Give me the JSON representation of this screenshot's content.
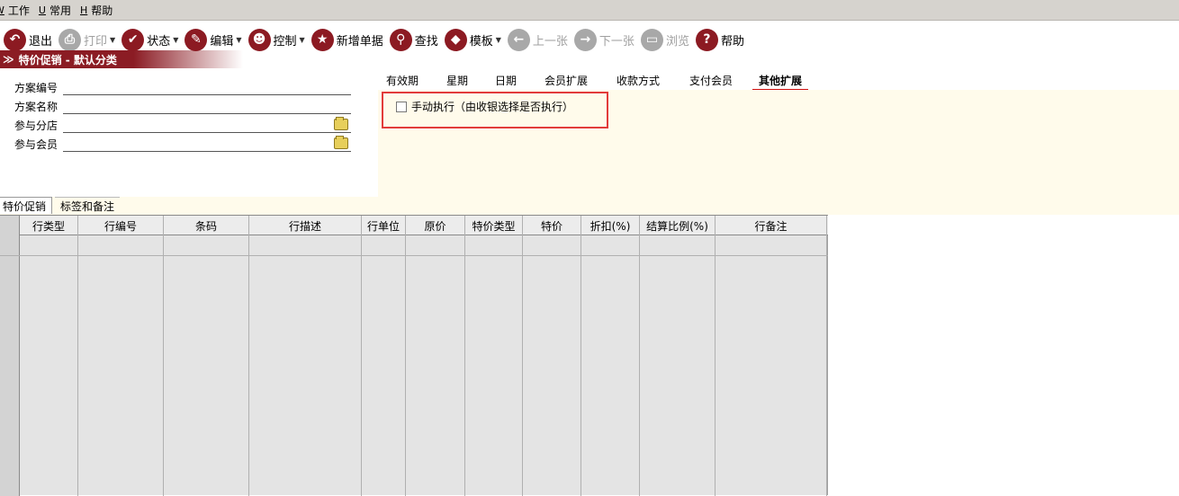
{
  "menu": [
    {
      "key": "W",
      "label": "工作"
    },
    {
      "key": "U",
      "label": "常用"
    },
    {
      "key": "H",
      "label": "帮助"
    }
  ],
  "toolbar": {
    "exit": "退出",
    "print": "打印",
    "status": "状态",
    "edit": "编辑",
    "control": "控制",
    "new_doc": "新增单据",
    "find": "查找",
    "template": "模板",
    "prev": "上一张",
    "next": "下一张",
    "browse": "浏览",
    "help": "帮助"
  },
  "banner": {
    "title": "特价促销 - 默认分类"
  },
  "form": {
    "plan_no_label": "方案编号",
    "plan_name_label": "方案名称",
    "branch_label": "参与分店",
    "member_label": "参与会员"
  },
  "tabs": [
    "有效期",
    "星期",
    "日期",
    "会员扩展",
    "收款方式",
    "支付会员",
    "其他扩展"
  ],
  "active_tab": "其他扩展",
  "manual_exec": {
    "label": "手动执行（由收银选择是否执行）",
    "checked": false
  },
  "lower_tabs": [
    "特价促销",
    "标签和备注"
  ],
  "grid": {
    "columns": [
      "行类型",
      "行编号",
      "条码",
      "行描述",
      "行单位",
      "原价",
      "特价类型",
      "特价",
      "折扣(%)",
      "结算比例(%)",
      "行备注"
    ]
  },
  "colors": {
    "accent": "#8c1a22",
    "highlight": "#e23b3b",
    "panel_bg": "#fffbeb"
  }
}
